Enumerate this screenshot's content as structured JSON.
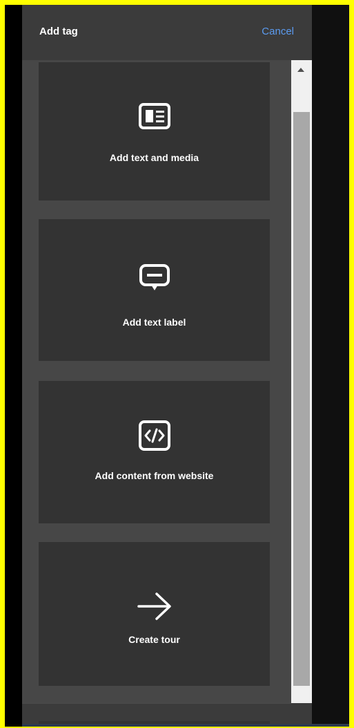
{
  "header": {
    "title": "Add tag",
    "cancel_label": "Cancel"
  },
  "cards": [
    {
      "label": "Add text and media",
      "icon": "text-media-icon"
    },
    {
      "label": "Add text label",
      "icon": "text-label-icon"
    },
    {
      "label": "Add content from website",
      "icon": "code-icon"
    },
    {
      "label": "Create tour",
      "icon": "arrow-right-icon"
    }
  ],
  "colors": {
    "border": "#ffff00",
    "panel": "#3b3b3b",
    "card": "#333333",
    "accent": "#5b9bf0"
  }
}
